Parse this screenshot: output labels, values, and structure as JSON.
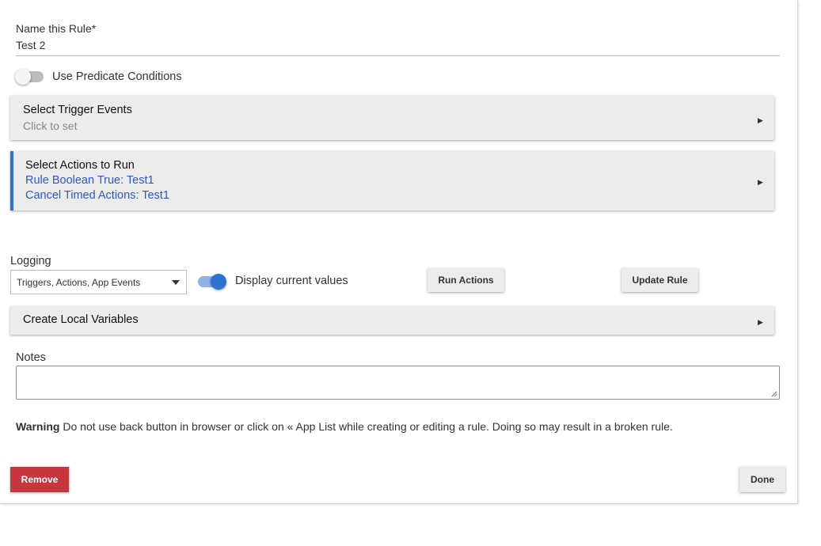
{
  "name_field": {
    "label": "Name this Rule*",
    "value": "Test 2"
  },
  "predicate": {
    "label": "Use Predicate Conditions",
    "enabled": false
  },
  "triggers": {
    "title": "Select Trigger Events",
    "subtitle": "Click to set",
    "arrow": "▶"
  },
  "actions": {
    "title": "Select Actions to Run",
    "items": [
      "Rule Boolean True: Test1",
      "Cancel Timed Actions: Test1"
    ],
    "arrow": "▶"
  },
  "logging": {
    "label": "Logging",
    "selected": "Triggers, Actions, App Events"
  },
  "display_values": {
    "label": "Display current values",
    "enabled": true
  },
  "buttons": {
    "run_actions": "Run Actions",
    "update_rule": "Update Rule",
    "remove": "Remove",
    "done": "Done"
  },
  "local_vars": {
    "title": "Create Local Variables",
    "arrow": "▶"
  },
  "notes": {
    "label": "Notes",
    "value": ""
  },
  "warning": {
    "strong": "Warning",
    "text": "Do not use back button in browser or click on « App List while creating or editing a rule. Doing so may result in a broken rule."
  },
  "colors": {
    "accent": "#2e72d2",
    "danger": "#c8363d",
    "link": "#2f58c8",
    "section_bg": "#ececec"
  }
}
